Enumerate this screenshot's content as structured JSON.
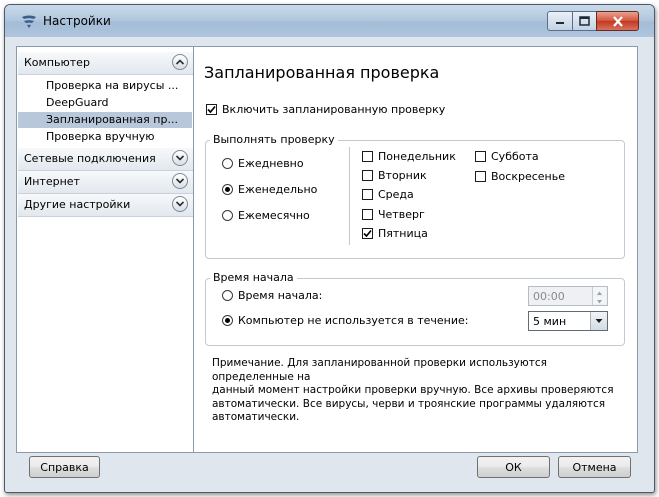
{
  "window": {
    "title": "Настройки",
    "controls": {
      "minimize": "minimize-icon",
      "maximize": "maximize-icon",
      "close": "close-icon"
    }
  },
  "sidebar": {
    "sections": [
      {
        "label": "Компьютер",
        "expanded": true,
        "icon": "chevron-up-icon",
        "items": [
          {
            "label": "Проверка на вирусы ..."
          },
          {
            "label": "DeepGuard"
          },
          {
            "label": "Запланированная пр...",
            "selected": true
          },
          {
            "label": "Проверка вручную"
          }
        ]
      },
      {
        "label": "Сетевые подключения",
        "expanded": false,
        "icon": "chevron-down-icon"
      },
      {
        "label": "Интернет",
        "expanded": false,
        "icon": "chevron-down-icon"
      },
      {
        "label": "Другие настройки",
        "expanded": false,
        "icon": "chevron-down-icon"
      }
    ]
  },
  "main": {
    "title": "Запланированная проверка",
    "enable_label": "Включить запланированную проверку",
    "enable_checked": true,
    "frequency": {
      "legend": "Выполнять проверку",
      "options": [
        {
          "label": "Ежедневно",
          "selected": false
        },
        {
          "label": "Еженедельно",
          "selected": true
        },
        {
          "label": "Ежемесячно",
          "selected": false
        }
      ],
      "days": [
        {
          "label": "Понедельник",
          "checked": false
        },
        {
          "label": "Вторник",
          "checked": false
        },
        {
          "label": "Среда",
          "checked": false
        },
        {
          "label": "Четверг",
          "checked": false
        },
        {
          "label": "Пятница",
          "checked": true
        },
        {
          "label": "Суббота",
          "checked": false
        },
        {
          "label": "Воскресенье",
          "checked": false
        }
      ]
    },
    "start": {
      "legend": "Время начала",
      "time_option": {
        "label": "Время начала:",
        "selected": false,
        "value": "00:00"
      },
      "idle_option": {
        "label": "Компьютер не используется в течение:",
        "selected": true,
        "value": "5 мин"
      }
    },
    "note": "Примечание. Для запланированной проверки используются определенные на\nданный момент настройки проверки вручную. Все архивы проверяются\nавтоматически. Все вирусы, черви и троянские программы удаляются\nавтоматически."
  },
  "footer": {
    "help": "Справка",
    "ok": "ОК",
    "cancel": "Отмена"
  },
  "colors": {
    "selection": "#b8c7da",
    "titlebar": "#b3c8de",
    "frame": "#dfe6ee",
    "close_button": "#d2533a"
  }
}
